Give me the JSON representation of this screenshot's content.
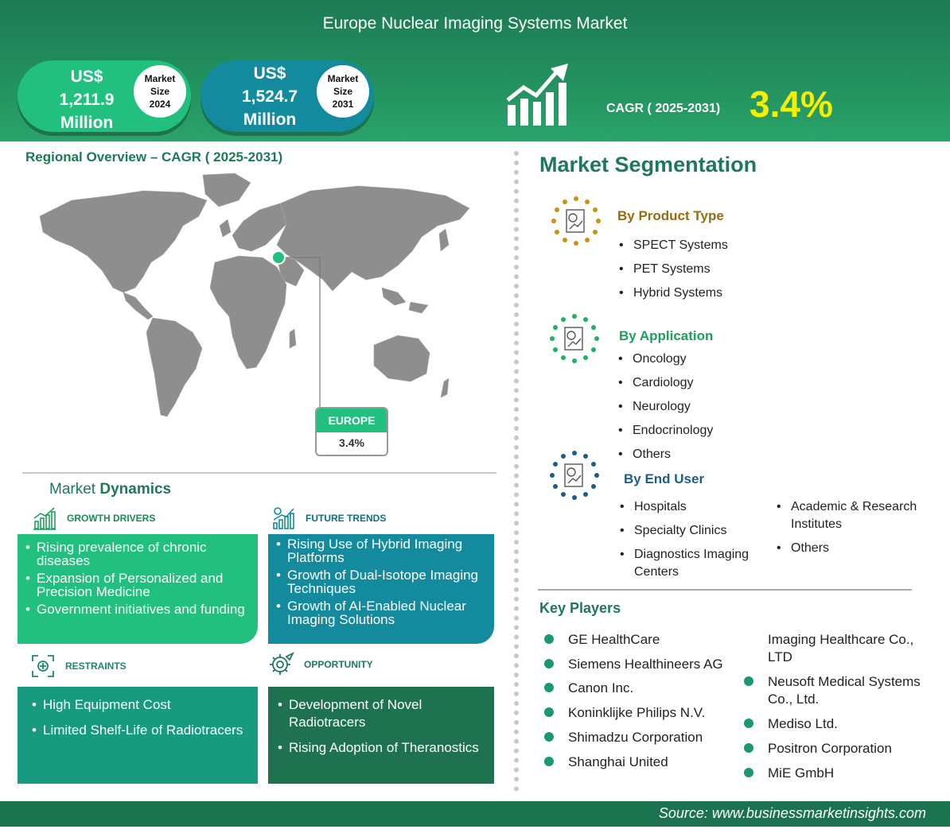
{
  "header": {
    "title": "Europe Nuclear Imaging Systems Market",
    "market_2024": {
      "currency": "US$",
      "value": "1,211.9",
      "unit": "Million",
      "label_line1": "Market",
      "label_line2": "Size",
      "year": "2024"
    },
    "market_2031": {
      "currency": "US$",
      "value": "1,524.7",
      "unit": "Million",
      "label_line1": "Market",
      "label_line2": "Size",
      "year": "2031"
    },
    "cagr_label": "CAGR ( 2025-2031)",
    "cagr_value": "3.4%"
  },
  "regional": {
    "title": "Regional Overview – CAGR ( 2025-2031)",
    "region_label": "EUROPE",
    "region_value": "3.4%"
  },
  "dynamics": {
    "title_prefix": "Market ",
    "title_bold": "Dynamics",
    "growth_drivers": {
      "heading": "GROWTH DRIVERS",
      "items": [
        "Rising prevalence of chronic diseases",
        "Expansion of Personalized and Precision Medicine",
        "Government initiatives and funding"
      ]
    },
    "future_trends": {
      "heading": "FUTURE TRENDS",
      "items": [
        "Rising Use of Hybrid Imaging Platforms",
        "Growth of Dual-Isotope Imaging Techniques",
        "Growth of AI-Enabled Nuclear Imaging Solutions"
      ]
    },
    "restraints": {
      "heading": "RESTRAINTS",
      "items": [
        "High Equipment Cost",
        "Limited Shelf-Life of Radiotracers"
      ]
    },
    "opportunity": {
      "heading": "OPPORTUNITY",
      "items": [
        "Development of Novel Radiotracers",
        "Rising Adoption of Theranostics"
      ]
    }
  },
  "segmentation": {
    "title": "Market Segmentation",
    "product_type": {
      "heading": "By Product Type",
      "color": "#9a6b0c",
      "items": [
        "SPECT Systems",
        "PET Systems",
        "Hybrid Systems"
      ]
    },
    "application": {
      "heading": "By Application",
      "color": "#1fa05a",
      "items": [
        "Oncology",
        "Cardiology",
        "Neurology",
        "Endocrinology",
        "Others"
      ]
    },
    "end_user": {
      "heading": "By End User",
      "color": "#1b5e8c",
      "items_col1": [
        "Hospitals",
        "Specialty Clinics",
        "Diagnostics Imaging Centers"
      ],
      "items_col2": [
        "Academic & Research Institutes",
        "Others"
      ]
    }
  },
  "key_players": {
    "title": "Key Players",
    "col1": [
      "GE HealthCare",
      "Siemens Healthineers AG",
      "Canon Inc.",
      "Koninklijke Philips N.V.",
      "Shimadzu Corporation",
      "Shanghai United"
    ],
    "col2_continuation": "Imaging Healthcare Co., LTD",
    "col2": [
      "Neusoft Medical Systems Co., Ltd.",
      "Mediso Ltd.",
      "Positron Corporation",
      "MiE GmbH"
    ]
  },
  "footer": {
    "source": "Source:  www.businessmarketinsights.com"
  },
  "colors": {
    "brand_green": "#1d7a55",
    "bright_green": "#22c07f",
    "teal": "#138a9e",
    "cagr_yellow": "#f4f000"
  }
}
